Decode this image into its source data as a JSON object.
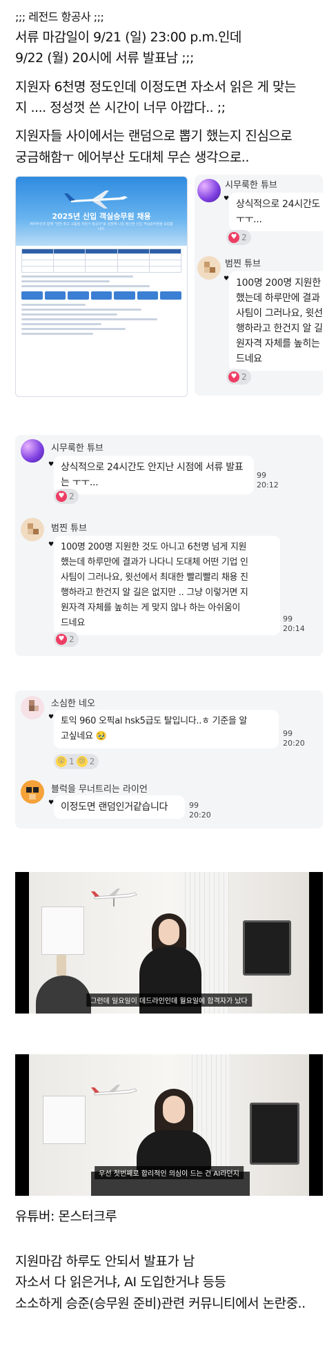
{
  "post": {
    "title": ";;; 레전드 항공사 ;;;",
    "line1": "서류 마감일이 9/21 (일) 23:00 p.m.인데",
    "line2": "9/22 (월) 20시에 서류 발표남 ;;;",
    "line3": "지원자 6천명 정도인데 이정도면 자소서 읽은 게 맞는",
    "line4": "지 .... 정성껏 쓴 시간이 너무 아깝다.. ;;",
    "line5": "지원자들 사이에서는 랜덤으로 뽑기 했는지 진심으로",
    "line6": "궁금해함ㅜ 에어부산 도대체 무슨 생각으로..",
    "youtuber": "유튜버: 몬스터크루",
    "footer1": "지원마감 하루도 안되서 발표가 남",
    "footer2": "자소서 다 읽은거냐, AI 도입한거냐 등등",
    "footer3": "소소하게 승준(승무원 준비)관련 커뮤니티에서 논란중.."
  },
  "poster": {
    "title": "2025년 신입 객실승무원 채용",
    "subtitle": "에어부산과 함께 \"안전 최고 고품질 저원가 항공사\"로 성장해 나갈 참신한 신입 객실승무원을 모집합니다."
  },
  "chat_preview": {
    "user1": "시무룩한 튜브",
    "msg1": "상식적으로 24시간도 안",
    "msg1b": "ㅜㅜ...",
    "react1_count": "2",
    "user2": "범찐 튜브",
    "msg2_lines": [
      "100명 200명 지원한",
      "했는데 하루만에 결과",
      "사팀이 그러나요, 윗선",
      "행하라고 한건지 알 길",
      "원자격 자체를 높히는",
      "드네요"
    ],
    "react2_count": "2"
  },
  "chat1": {
    "user1": "시무룩한 튜브",
    "msg1": "상식적으로 24시간도 안지난 시점에 서류 발표는 ㅜㅜ...",
    "msg1_count": "99",
    "msg1_time": "20:12",
    "react1_count": "2",
    "user2": "범찐 튜브",
    "msg2_lines": [
      "100명 200명 지원한 것도 아니고 6천명 넘게 지원",
      "했는데 하루만에 결과가 나다니 도대체 어떤 기업 인",
      "사팀이 그러나요, 윗선에서 최대한 빨리빨리 채용 진",
      "행하라고 한건지 알 길은 없지만 .. 그냥 이렇거면 지",
      "원자격 자체를 높히는 게 맞지 않나 하는 아쉬움이",
      "드네요"
    ],
    "msg2_count": "99",
    "msg2_time": "20:14",
    "react2_count": "2"
  },
  "chat2": {
    "user1": "소심한 네오",
    "msg1_line1": "토익 960 오픽al hsk5급도 탈입니다..ㅎ 기준을 알",
    "msg1_line2": "고싶네요 🥹",
    "msg1_count": "99",
    "msg1_time": "20:20",
    "react1a_count": "1",
    "react1b_count": "2",
    "user2": "블럭을 무너트리는 라이언",
    "msg2": "이정도면 랜덤인거같습니다",
    "msg2_count": "99",
    "msg2_time": "20:20"
  },
  "video1": {
    "caption": "그런데 일요일이 데드라인인데 월요일에 합격자가 났다"
  },
  "video2": {
    "caption": "우선 첫번째로 합리적인 의심이 드는 건 AI라던지"
  },
  "colors": {
    "heart": "#ee3d64",
    "chat_bg": "#f4f5f7",
    "poster_blue": "#2f8be0"
  }
}
